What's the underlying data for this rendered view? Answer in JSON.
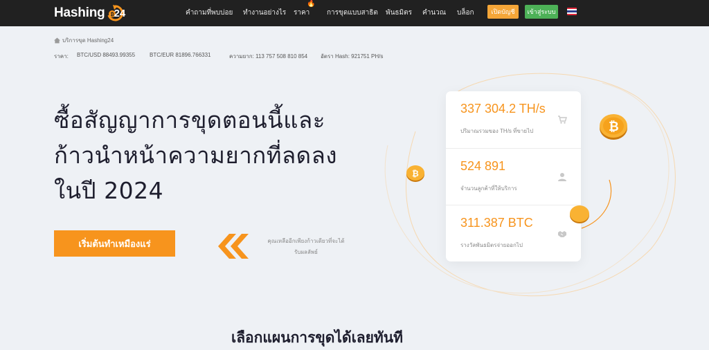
{
  "header": {
    "logo_text": "Hashing",
    "logo_number": "24",
    "nav": [
      {
        "label": "คำถามที่พบบ่อย"
      },
      {
        "label": "ทำงานอย่างไร"
      },
      {
        "label": "ราคา"
      },
      {
        "label": "การขุดแบบสาธิต"
      },
      {
        "label": "พันธมิตร"
      },
      {
        "label": "คำนวณ"
      },
      {
        "label": "บล็อก"
      }
    ],
    "register_label": "เปิดบัญชี",
    "login_label": "เข้าสู่ระบบ",
    "flag_icon": "thailand-flag-icon"
  },
  "breadcrumb": {
    "label": "บริการขุด Hashing24"
  },
  "ticker": {
    "rate_label": "ราคา:",
    "btc_usd": "BTC/USD 88493.99355",
    "btc_eur": "BTC/EUR 81896.766331",
    "difficulty": "ความยาก: 113 757 508 810 854",
    "hashrate": "อัตรา Hash: 921751 PH/s"
  },
  "hero": {
    "title_line1": "ซื้อสัญญาการขุดตอนนี้และ",
    "title_line2": "ก้าวนำหน้าความยากที่ลดลง",
    "title_line3": "ในปี 2024",
    "cta_label": "เริ่มต้นทำเหมืองแร่",
    "hint_line1": "คุณเหลืออีกเพียงก้าวเดียวที่จะได้",
    "hint_line2": "รับผลลัพธ์"
  },
  "stats": [
    {
      "value": "337 304.2 TH/s",
      "label": "ปริมาณรวมของ TH/s ที่ขายไป",
      "icon": "cart-icon"
    },
    {
      "value": "524 891",
      "label": "จำนวนลูกค้าที่ให้บริการ",
      "icon": "user-icon"
    },
    {
      "value": "311.387 BTC",
      "label": "รางวัลพันธมิตรจ่ายออกไป",
      "icon": "handshake-icon"
    }
  ],
  "section": {
    "title": "เลือกแผนการขุดได้เลยทันที"
  },
  "colors": {
    "accent": "#f7941d",
    "header_bg": "#212121",
    "login_green": "#4db157",
    "register_orange": "#f5a638",
    "page_bg": "#eef1f5"
  }
}
